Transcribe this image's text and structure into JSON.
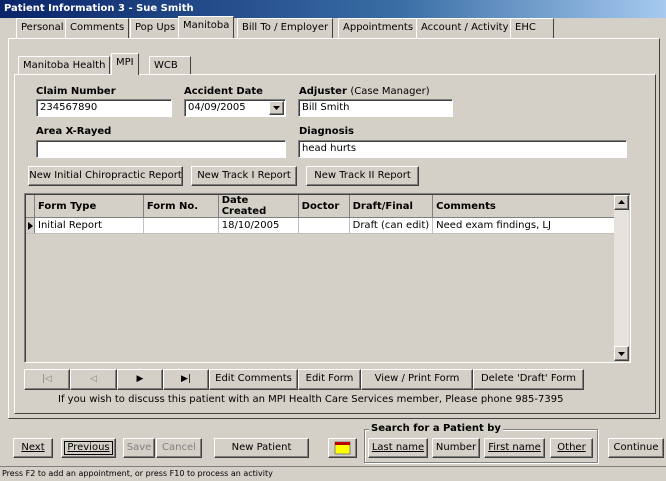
{
  "window": {
    "title": "Patient Information    3 - Sue Smith"
  },
  "tabs": [
    "Personal",
    "Comments",
    "Pop Ups",
    "Manitoba",
    "Bill To / Employer",
    "Appointments",
    "Account / Activity",
    "EHC"
  ],
  "subtabs": [
    "Manitoba Health",
    "MPI",
    "WCB"
  ],
  "form": {
    "claim_label": "Claim Number",
    "claim_value": "234567890",
    "accident_label": "Accident Date",
    "accident_value": "04/09/2005",
    "adjuster_label": "Adjuster",
    "adjuster_sub": "(Case Manager)",
    "adjuster_value": "Bill Smith",
    "area_label": "Area X-Rayed",
    "area_value": "",
    "diagnosis_label": "Diagnosis",
    "diagnosis_value": "head hurts"
  },
  "report_buttons": [
    "New Initial Chiropractic Report",
    "New Track I Report",
    "New Track II Report"
  ],
  "grid": {
    "columns": [
      "Form Type",
      "Form No.",
      "Date Created",
      "Doctor",
      "Draft/Final",
      "Comments"
    ],
    "rows": [
      {
        "form_type": "Initial Report",
        "form_no": "",
        "date_created": "18/10/2005",
        "doctor": "",
        "draft_final": "Draft (can edit)",
        "comments": "Need exam findings, LJ"
      }
    ]
  },
  "nav": {
    "first": "|◁",
    "prev": "◁",
    "next": "▶",
    "last": "▶|"
  },
  "grid_actions": [
    "Edit Comments",
    "Edit Form",
    "View / Print Form",
    "Delete 'Draft' Form"
  ],
  "info_text": "If you wish to discuss this patient with an MPI Health Care Services member, Please phone 985-7395",
  "bottom": {
    "next": "Next",
    "previous": "Previous",
    "save": "Save",
    "cancel": "Cancel",
    "new_patient": "New Patient",
    "search_title": "Search for a Patient by",
    "search_buttons": [
      "Last name",
      "Number",
      "First name",
      "Other"
    ],
    "continue": "Continue"
  },
  "status_bar": "Press F2 to add an appointment,    or press F10 to process an activity",
  "colors": {
    "title_start": "#0a246a",
    "title_end": "#a6caf0",
    "face": "#d4d0c8",
    "note_icon": "#ffff00"
  }
}
